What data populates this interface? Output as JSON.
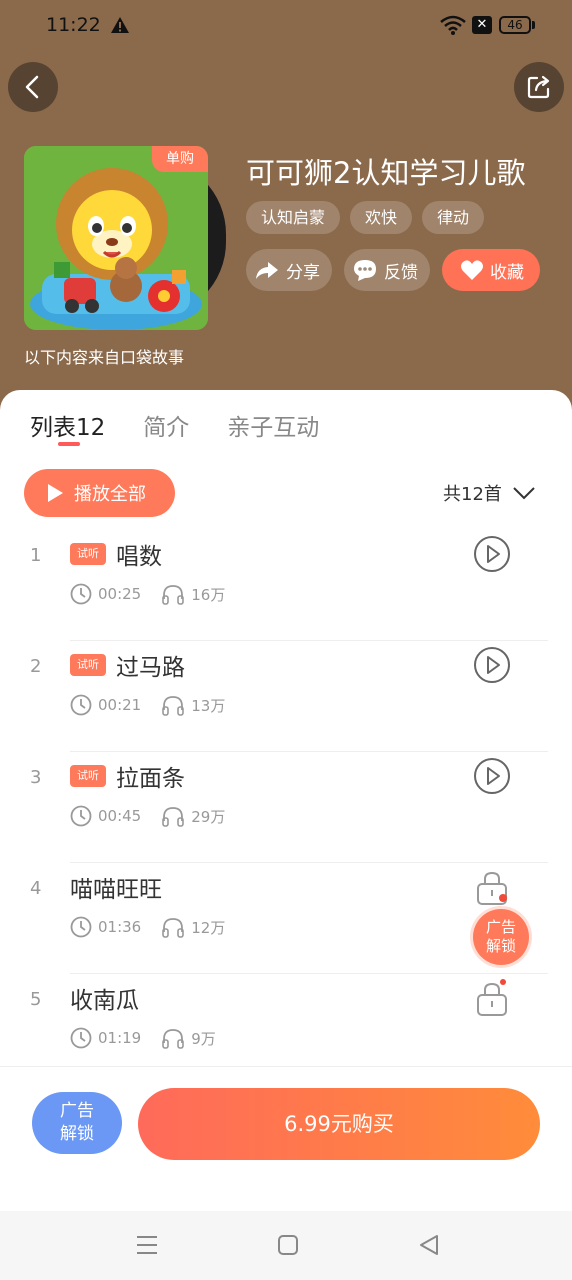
{
  "status": {
    "time": "11:22",
    "battery": "46",
    "sim_label": "✕"
  },
  "album": {
    "title": "可可狮2认知学习儿歌",
    "badge": "单购",
    "source": "以下内容来自口袋故事",
    "tags": [
      "认知启蒙",
      "欢快",
      "律动"
    ],
    "actions": {
      "share": "分享",
      "feedback": "反馈",
      "favorite": "收藏"
    }
  },
  "tabs": [
    "列表12",
    "简介",
    "亲子互动"
  ],
  "list_header": {
    "play_all": "播放全部",
    "count": "共12首"
  },
  "tracks": [
    {
      "num": "1",
      "trial": "试听",
      "title": "唱数",
      "duration": "00:25",
      "plays": "16万",
      "locked": false
    },
    {
      "num": "2",
      "trial": "试听",
      "title": "过马路",
      "duration": "00:21",
      "plays": "13万",
      "locked": false
    },
    {
      "num": "3",
      "trial": "试听",
      "title": "拉面条",
      "duration": "00:45",
      "plays": "29万",
      "locked": false
    },
    {
      "num": "4",
      "trial": "",
      "title": "喵喵旺旺",
      "duration": "01:36",
      "plays": "12万",
      "locked": true
    },
    {
      "num": "5",
      "trial": "",
      "title": "收南瓜",
      "duration": "01:19",
      "plays": "9万",
      "locked": true
    }
  ],
  "float_ad": {
    "line1": "广告",
    "line2": "解锁"
  },
  "bottom": {
    "ad_line1": "广告",
    "ad_line2": "解锁",
    "buy": "6.99元购买"
  },
  "colors": {
    "header_bg": "#8b6a4c",
    "accent": "#ff7a5a",
    "ad_blue": "#6b98f5"
  },
  "icons": [
    "back-icon",
    "share-out-icon",
    "share-arrow-icon",
    "feedback-icon",
    "heart-icon",
    "play-triangle-icon",
    "chevron-down-icon",
    "clock-icon",
    "headphones-icon",
    "play-circle-icon",
    "lock-icon",
    "menu-icon",
    "home-square-icon",
    "back-triangle-icon"
  ]
}
